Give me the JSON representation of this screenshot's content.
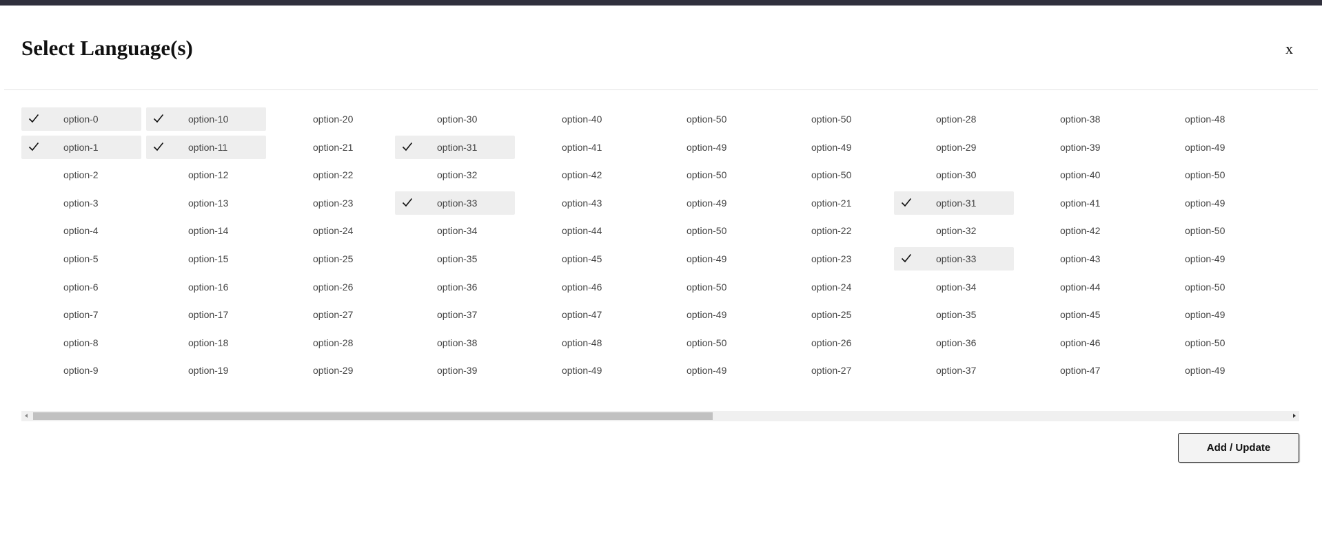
{
  "dialog": {
    "title": "Select Language(s)",
    "close_label": "x",
    "submit_label": "Add / Update"
  },
  "options": {
    "columns": [
      [
        {
          "label": "option-0",
          "selected": true
        },
        {
          "label": "option-1",
          "selected": true
        },
        {
          "label": "option-2",
          "selected": false
        },
        {
          "label": "option-3",
          "selected": false
        },
        {
          "label": "option-4",
          "selected": false
        },
        {
          "label": "option-5",
          "selected": false
        },
        {
          "label": "option-6",
          "selected": false
        },
        {
          "label": "option-7",
          "selected": false
        },
        {
          "label": "option-8",
          "selected": false
        },
        {
          "label": "option-9",
          "selected": false
        }
      ],
      [
        {
          "label": "option-10",
          "selected": true
        },
        {
          "label": "option-11",
          "selected": true
        },
        {
          "label": "option-12",
          "selected": false
        },
        {
          "label": "option-13",
          "selected": false
        },
        {
          "label": "option-14",
          "selected": false
        },
        {
          "label": "option-15",
          "selected": false
        },
        {
          "label": "option-16",
          "selected": false
        },
        {
          "label": "option-17",
          "selected": false
        },
        {
          "label": "option-18",
          "selected": false
        },
        {
          "label": "option-19",
          "selected": false
        }
      ],
      [
        {
          "label": "option-20",
          "selected": false
        },
        {
          "label": "option-21",
          "selected": false
        },
        {
          "label": "option-22",
          "selected": false
        },
        {
          "label": "option-23",
          "selected": false
        },
        {
          "label": "option-24",
          "selected": false
        },
        {
          "label": "option-25",
          "selected": false
        },
        {
          "label": "option-26",
          "selected": false
        },
        {
          "label": "option-27",
          "selected": false
        },
        {
          "label": "option-28",
          "selected": false
        },
        {
          "label": "option-29",
          "selected": false
        }
      ],
      [
        {
          "label": "option-30",
          "selected": false
        },
        {
          "label": "option-31",
          "selected": true
        },
        {
          "label": "option-32",
          "selected": false
        },
        {
          "label": "option-33",
          "selected": true
        },
        {
          "label": "option-34",
          "selected": false
        },
        {
          "label": "option-35",
          "selected": false
        },
        {
          "label": "option-36",
          "selected": false
        },
        {
          "label": "option-37",
          "selected": false
        },
        {
          "label": "option-38",
          "selected": false
        },
        {
          "label": "option-39",
          "selected": false
        }
      ],
      [
        {
          "label": "option-40",
          "selected": false
        },
        {
          "label": "option-41",
          "selected": false
        },
        {
          "label": "option-42",
          "selected": false
        },
        {
          "label": "option-43",
          "selected": false
        },
        {
          "label": "option-44",
          "selected": false
        },
        {
          "label": "option-45",
          "selected": false
        },
        {
          "label": "option-46",
          "selected": false
        },
        {
          "label": "option-47",
          "selected": false
        },
        {
          "label": "option-48",
          "selected": false
        },
        {
          "label": "option-49",
          "selected": false
        }
      ],
      [
        {
          "label": "option-50",
          "selected": false
        },
        {
          "label": "option-49",
          "selected": false
        },
        {
          "label": "option-50",
          "selected": false
        },
        {
          "label": "option-49",
          "selected": false
        },
        {
          "label": "option-50",
          "selected": false
        },
        {
          "label": "option-49",
          "selected": false
        },
        {
          "label": "option-50",
          "selected": false
        },
        {
          "label": "option-49",
          "selected": false
        },
        {
          "label": "option-50",
          "selected": false
        },
        {
          "label": "option-49",
          "selected": false
        }
      ],
      [
        {
          "label": "option-50",
          "selected": false
        },
        {
          "label": "option-49",
          "selected": false
        },
        {
          "label": "option-50",
          "selected": false
        },
        {
          "label": "option-21",
          "selected": false
        },
        {
          "label": "option-22",
          "selected": false
        },
        {
          "label": "option-23",
          "selected": false
        },
        {
          "label": "option-24",
          "selected": false
        },
        {
          "label": "option-25",
          "selected": false
        },
        {
          "label": "option-26",
          "selected": false
        },
        {
          "label": "option-27",
          "selected": false
        }
      ],
      [
        {
          "label": "option-28",
          "selected": false
        },
        {
          "label": "option-29",
          "selected": false
        },
        {
          "label": "option-30",
          "selected": false
        },
        {
          "label": "option-31",
          "selected": true
        },
        {
          "label": "option-32",
          "selected": false
        },
        {
          "label": "option-33",
          "selected": true
        },
        {
          "label": "option-34",
          "selected": false
        },
        {
          "label": "option-35",
          "selected": false
        },
        {
          "label": "option-36",
          "selected": false
        },
        {
          "label": "option-37",
          "selected": false
        }
      ],
      [
        {
          "label": "option-38",
          "selected": false
        },
        {
          "label": "option-39",
          "selected": false
        },
        {
          "label": "option-40",
          "selected": false
        },
        {
          "label": "option-41",
          "selected": false
        },
        {
          "label": "option-42",
          "selected": false
        },
        {
          "label": "option-43",
          "selected": false
        },
        {
          "label": "option-44",
          "selected": false
        },
        {
          "label": "option-45",
          "selected": false
        },
        {
          "label": "option-46",
          "selected": false
        },
        {
          "label": "option-47",
          "selected": false
        }
      ],
      [
        {
          "label": "option-48",
          "selected": false
        },
        {
          "label": "option-49",
          "selected": false
        },
        {
          "label": "option-50",
          "selected": false
        },
        {
          "label": "option-49",
          "selected": false
        },
        {
          "label": "option-50",
          "selected": false
        },
        {
          "label": "option-49",
          "selected": false
        },
        {
          "label": "option-50",
          "selected": false
        },
        {
          "label": "option-49",
          "selected": false
        },
        {
          "label": "option-50",
          "selected": false
        },
        {
          "label": "option-49",
          "selected": false
        }
      ]
    ]
  },
  "icons": {
    "selected_marker": "check-icon",
    "close": "close-icon",
    "scroll_left": "chevron-left-icon",
    "scroll_right": "chevron-right-icon"
  },
  "colors": {
    "top_strip": "#30303d",
    "selected_bg": "#eeeeee",
    "text": "#444444"
  }
}
